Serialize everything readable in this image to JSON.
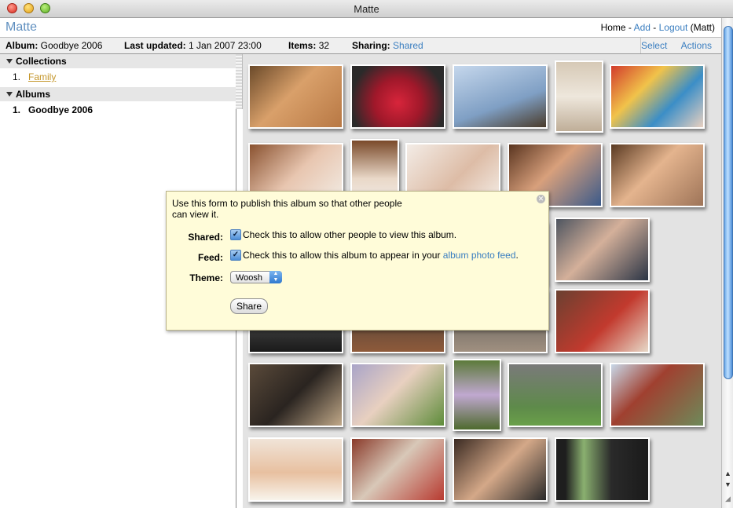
{
  "window": {
    "title": "Matte"
  },
  "header": {
    "brand": "Matte",
    "nav_home": "Home",
    "nav_sep1": " - ",
    "nav_add": "Add",
    "nav_sep2": " - ",
    "nav_logout": "Logout",
    "nav_user": " (Matt)"
  },
  "infobar": {
    "album_label": "Album:",
    "album_value": "Goodbye 2006",
    "updated_label": "Last updated:",
    "updated_value": "1 Jan 2007 23:00",
    "items_label": "Items:",
    "items_value": "32",
    "sharing_label": "Sharing:",
    "sharing_value": "Shared",
    "select_label": "Select",
    "actions_label": "Actions"
  },
  "sidebar": {
    "collections_heading": "Collections",
    "collections": [
      {
        "num": "1.",
        "label": "Family"
      }
    ],
    "albums_heading": "Albums",
    "albums": [
      {
        "num": "1.",
        "label": "Goodbye 2006"
      }
    ]
  },
  "popup": {
    "description": "Use this form to publish this album so that other people can view it.",
    "shared_label": "Shared:",
    "shared_text": "Check this to allow other people to view this album.",
    "shared_checked": true,
    "feed_label": "Feed:",
    "feed_text": "Check this to allow this album to appear in your ",
    "feed_link": "album photo feed",
    "feed_tail": ".",
    "feed_checked": true,
    "theme_label": "Theme:",
    "theme_value": "Woosh",
    "share_button": "Share"
  },
  "colors": {
    "link": "#3a7ec0",
    "brand": "#5f8fbf",
    "popup_bg": "#fffcd9",
    "folder_link": "#c4962a"
  },
  "icons": {
    "close": "close-icon",
    "disclosure": "disclosure-triangle-icon",
    "checkmark": "checkmark-icon"
  }
}
